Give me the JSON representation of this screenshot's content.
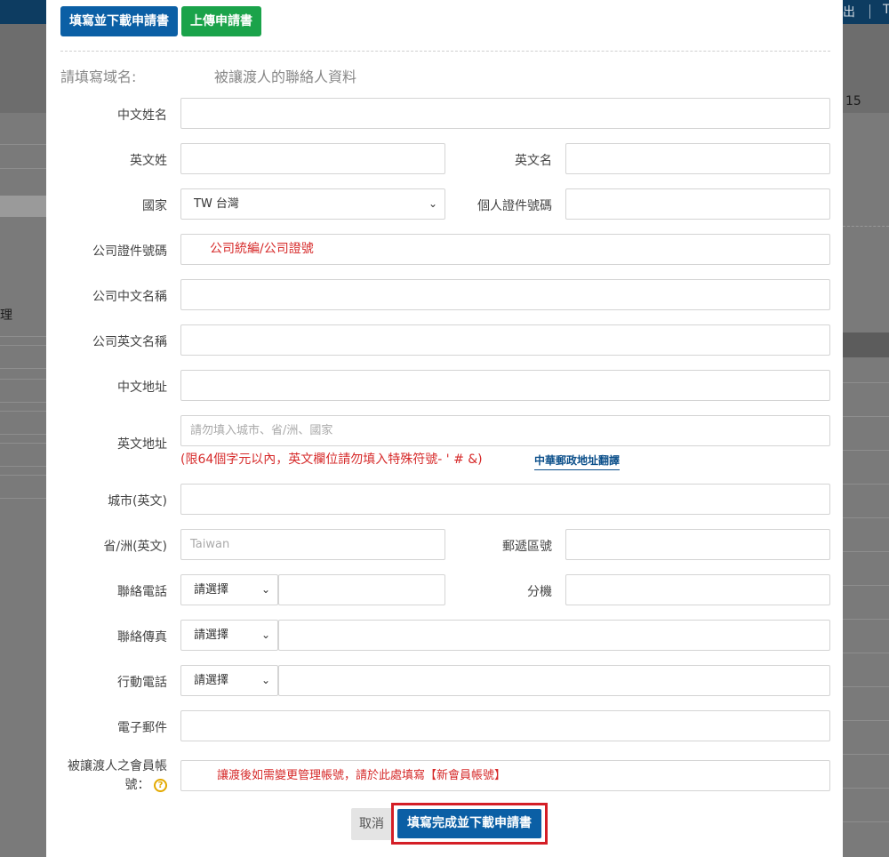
{
  "background": {
    "topbar_right": "出",
    "topbar_right_2": "T",
    "left_text": "理",
    "right_number": "15"
  },
  "toolbar": {
    "fill_download_label": "填寫並下載申請書",
    "upload_label": "上傳申請書"
  },
  "section": {
    "domain_label": "請填寫域名:",
    "contact_title": "被讓渡人的聯絡人資料"
  },
  "form": {
    "chinese_name": {
      "label": "中文姓名",
      "value": ""
    },
    "english_surname": {
      "label": "英文姓",
      "value": ""
    },
    "english_given_name": {
      "label": "英文名",
      "value": ""
    },
    "country": {
      "label": "國家",
      "value": "TW 台灣"
    },
    "personal_id": {
      "label": "個人證件號碼",
      "value": ""
    },
    "company_id": {
      "label": "公司證件號碼",
      "value": "公司統編/公司證號"
    },
    "company_chinese_name": {
      "label": "公司中文名稱",
      "value": ""
    },
    "company_english_name": {
      "label": "公司英文名稱",
      "value": ""
    },
    "chinese_address": {
      "label": "中文地址",
      "value": ""
    },
    "english_address": {
      "label": "英文地址",
      "placeholder": "請勿填入城市、省/洲、國家",
      "note": "(限64個字元以內，英文欄位請勿填入特殊符號- ' # &)",
      "link": "中華郵政地址翻譯"
    },
    "city": {
      "label": "城市(英文)",
      "value": ""
    },
    "province": {
      "label": "省/洲(英文)",
      "placeholder": "Taiwan"
    },
    "postal_code": {
      "label": "郵遞區號",
      "value": ""
    },
    "phone": {
      "label": "聯絡電話",
      "select": "請選擇",
      "value": ""
    },
    "extension": {
      "label": "分機",
      "value": ""
    },
    "fax": {
      "label": "聯絡傳真",
      "select": "請選擇",
      "value": ""
    },
    "mobile": {
      "label": "行動電話",
      "select": "請選擇",
      "value": ""
    },
    "email": {
      "label": "電子郵件",
      "value": ""
    },
    "member_account": {
      "label_line1": "被讓渡人之會員帳",
      "label_line2": "號：",
      "value": "讓渡後如需變更管理帳號，請於此處填寫【新會員帳號】"
    }
  },
  "footer": {
    "cancel_label": "取消",
    "submit_label": "填寫完成並下載申請書"
  }
}
